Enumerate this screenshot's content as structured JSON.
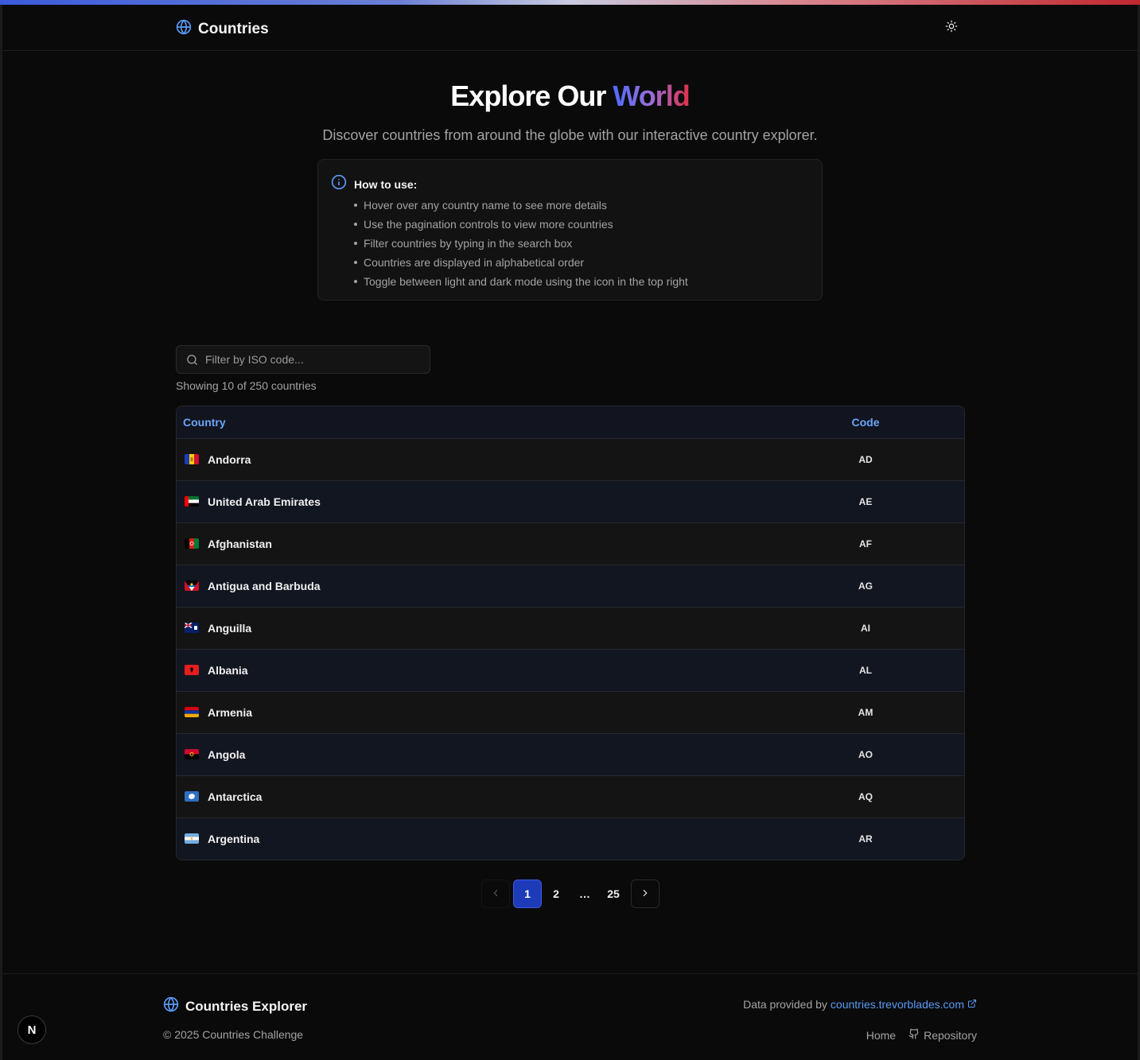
{
  "header": {
    "brand": "Countries",
    "theme_icon": "sun-icon"
  },
  "hero": {
    "title_main": "Explore Our ",
    "title_accent": "World",
    "subtitle": "Discover countries from around the globe with our interactive country explorer."
  },
  "howto": {
    "title": "How to use:",
    "items": [
      "Hover over any country name to see more details",
      "Use the pagination controls to view more countries",
      "Filter countries by typing in the search box",
      "Countries are displayed in alphabetical order",
      "Toggle between light and dark mode using the icon in the top right"
    ]
  },
  "search": {
    "placeholder": "Filter by ISO code...",
    "value": ""
  },
  "showing": "Showing 10 of 250 countries",
  "table": {
    "columns": [
      "Country",
      "Code"
    ],
    "rows": [
      {
        "name": "Andorra",
        "code": "AD",
        "flag": "andorra"
      },
      {
        "name": "United Arab Emirates",
        "code": "AE",
        "flag": "uae"
      },
      {
        "name": "Afghanistan",
        "code": "AF",
        "flag": "afghanistan"
      },
      {
        "name": "Antigua and Barbuda",
        "code": "AG",
        "flag": "antigua"
      },
      {
        "name": "Anguilla",
        "code": "AI",
        "flag": "anguilla"
      },
      {
        "name": "Albania",
        "code": "AL",
        "flag": "albania"
      },
      {
        "name": "Armenia",
        "code": "AM",
        "flag": "armenia"
      },
      {
        "name": "Angola",
        "code": "AO",
        "flag": "angola"
      },
      {
        "name": "Antarctica",
        "code": "AQ",
        "flag": "antarctica"
      },
      {
        "name": "Argentina",
        "code": "AR",
        "flag": "argentina"
      }
    ]
  },
  "pagination": {
    "pages": [
      "1",
      "2",
      "…",
      "25"
    ],
    "current": "1"
  },
  "footer": {
    "brand": "Countries Explorer",
    "copyright": "© 2025 Countries Challenge",
    "data_prefix": "Data provided by",
    "data_link": "countries.trevorblades.com",
    "home": "Home",
    "repository": "Repository"
  },
  "next_badge": "N",
  "colors": {
    "accent_blue": "#6aa5f5",
    "active_page": "#1d3bb8",
    "link": "#5a9af5"
  }
}
